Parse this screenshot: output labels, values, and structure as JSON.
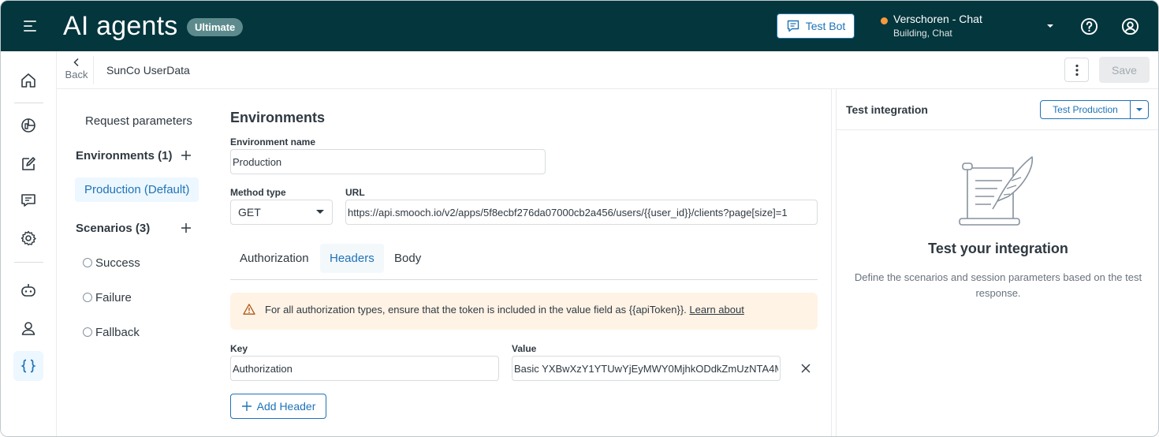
{
  "header": {
    "title": "AI agents",
    "plan_badge": "Ultimate",
    "test_bot_label": "Test Bot",
    "workspace_name": "Verschoren - Chat",
    "workspace_sub": "Building, Chat",
    "status_color": "#f79a3e",
    "bg_color": "#03363d"
  },
  "nav": {
    "items": [
      "home-icon",
      "analytics-icon",
      "edit-icon",
      "chat-icon",
      "settings-icon",
      "bot-icon",
      "user-icon",
      "code-braces-icon"
    ],
    "active": "code-braces-icon"
  },
  "subheader": {
    "back_label": "Back",
    "integration_name": "SunCo UserData",
    "save_label": "Save"
  },
  "secnav": {
    "request_parameters": "Request parameters",
    "environments_heading": "Environments (1)",
    "active_environment": "Production (Default)",
    "scenarios_heading": "Scenarios (3)",
    "scenarios": [
      "Success",
      "Failure",
      "Fallback"
    ]
  },
  "form": {
    "section_title": "Environments",
    "env_name_label": "Environment name",
    "env_name_value": "Production",
    "method_label": "Method type",
    "method_value": "GET",
    "url_label": "URL",
    "url_value": "https://api.smooch.io/v2/apps/5f8ecbf276da07000cb2a456/users/{{user_id}}/clients?page[size]=1",
    "tabs": [
      "Authorization",
      "Headers",
      "Body"
    ],
    "selected_tab": "Headers",
    "alert_text": "For all authorization types, ensure that the token is included in the value field as {{apiToken}}.",
    "alert_link": "Learn about",
    "key_label": "Key",
    "key_value": "Authorization",
    "value_label": "Value",
    "value_value": "Basic YXBwXzY1YTUwYjEyMWY0MjhkODdkZmUzNTA4M",
    "add_header_label": "Add Header"
  },
  "test_panel": {
    "title": "Test integration",
    "env_button": "Test Production",
    "empty_title": "Test your integration",
    "empty_desc": "Define the scenarios and session parameters based on the test response."
  }
}
